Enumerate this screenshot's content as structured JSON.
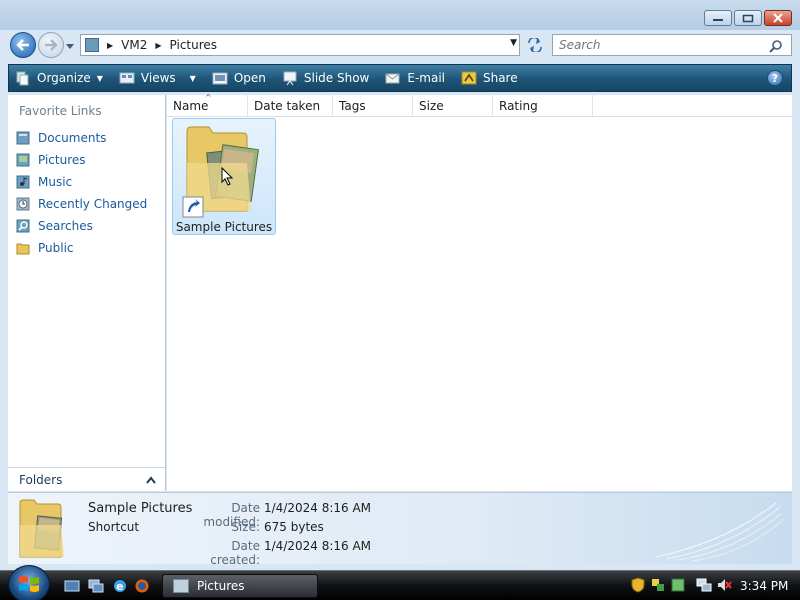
{
  "window": {
    "colors": {
      "frame": "#d9e6f3",
      "toolbar": "#1e5477",
      "link": "#1a5a9f",
      "selection": "#cde6fa"
    }
  },
  "address": {
    "crumbs": [
      "VM2",
      "Pictures"
    ],
    "search_placeholder": "Search"
  },
  "toolbar": {
    "organize": "Organize",
    "views": "Views",
    "open": "Open",
    "slideshow": "Slide Show",
    "email": "E-mail",
    "share": "Share",
    "help": "?"
  },
  "navpane": {
    "title": "Favorite Links",
    "items": [
      {
        "label": "Documents",
        "icon": "documents-icon"
      },
      {
        "label": "Pictures",
        "icon": "pictures-icon"
      },
      {
        "label": "Music",
        "icon": "music-icon"
      },
      {
        "label": "Recently Changed",
        "icon": "recent-icon"
      },
      {
        "label": "Searches",
        "icon": "searches-icon"
      },
      {
        "label": "Public",
        "icon": "folder-icon"
      }
    ],
    "folders_label": "Folders"
  },
  "content": {
    "columns": [
      "Name",
      "Date taken",
      "Tags",
      "Size",
      "Rating"
    ],
    "items": [
      {
        "label": "Sample Pictures"
      }
    ]
  },
  "details": {
    "name": "Sample Pictures",
    "type": "Shortcut",
    "rows": [
      {
        "key": "Date modified:",
        "value": "1/4/2024 8:16 AM"
      },
      {
        "key": "Size:",
        "value": "675 bytes"
      },
      {
        "key": "Date created:",
        "value": "1/4/2024 8:16 AM"
      }
    ]
  },
  "taskbar": {
    "task_label": "Pictures",
    "clock": "3:34 PM"
  }
}
